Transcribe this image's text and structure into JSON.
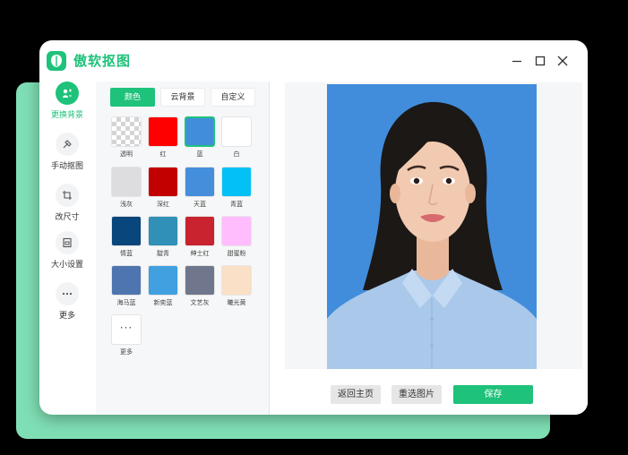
{
  "app": {
    "title": "傲软抠图"
  },
  "nav": [
    {
      "label": "更换背景",
      "icon": "change-background-icon",
      "active": true
    },
    {
      "label": "手动抠图",
      "icon": "manual-cutout-icon",
      "active": false
    },
    {
      "label": "改尺寸",
      "icon": "crop-icon",
      "active": false
    },
    {
      "label": "大小设置",
      "icon": "file-size-icon",
      "active": false
    },
    {
      "label": "更多",
      "icon": "more-icon",
      "active": false
    }
  ],
  "tabs": [
    {
      "label": "颜色",
      "active": true
    },
    {
      "label": "云背景",
      "active": false
    },
    {
      "label": "自定义",
      "active": false
    }
  ],
  "swatches": [
    {
      "label": "透明",
      "color": "transparent"
    },
    {
      "label": "红",
      "color": "#ff0000"
    },
    {
      "label": "蓝",
      "color": "#418ddc",
      "selected": true
    },
    {
      "label": "白",
      "color": "#ffffff"
    },
    {
      "label": "浅灰",
      "color": "#dddde0"
    },
    {
      "label": "深红",
      "color": "#c30000"
    },
    {
      "label": "天蓝",
      "color": "#448edb"
    },
    {
      "label": "青蓝",
      "color": "#03c0f5"
    },
    {
      "label": "情蓝",
      "color": "#08467b"
    },
    {
      "label": "靛青",
      "color": "#3090b7"
    },
    {
      "label": "绅士红",
      "color": "#c8232e"
    },
    {
      "label": "甜蜜粉",
      "color": "#ffbdfd"
    },
    {
      "label": "海马蓝",
      "color": "#4f75b0"
    },
    {
      "label": "新奕蓝",
      "color": "#40a0e0"
    },
    {
      "label": "文艺灰",
      "color": "#70778c"
    },
    {
      "label": "曦光黄",
      "color": "#fbe0c8"
    },
    {
      "label": "更多",
      "color": "more"
    }
  ],
  "more_symbol": "···",
  "buttons": {
    "back_home": "返回主页",
    "reselect": "重选图片",
    "save": "保存"
  },
  "colors": {
    "accent": "#1ec27a",
    "photo_bg": "#418ddc"
  }
}
